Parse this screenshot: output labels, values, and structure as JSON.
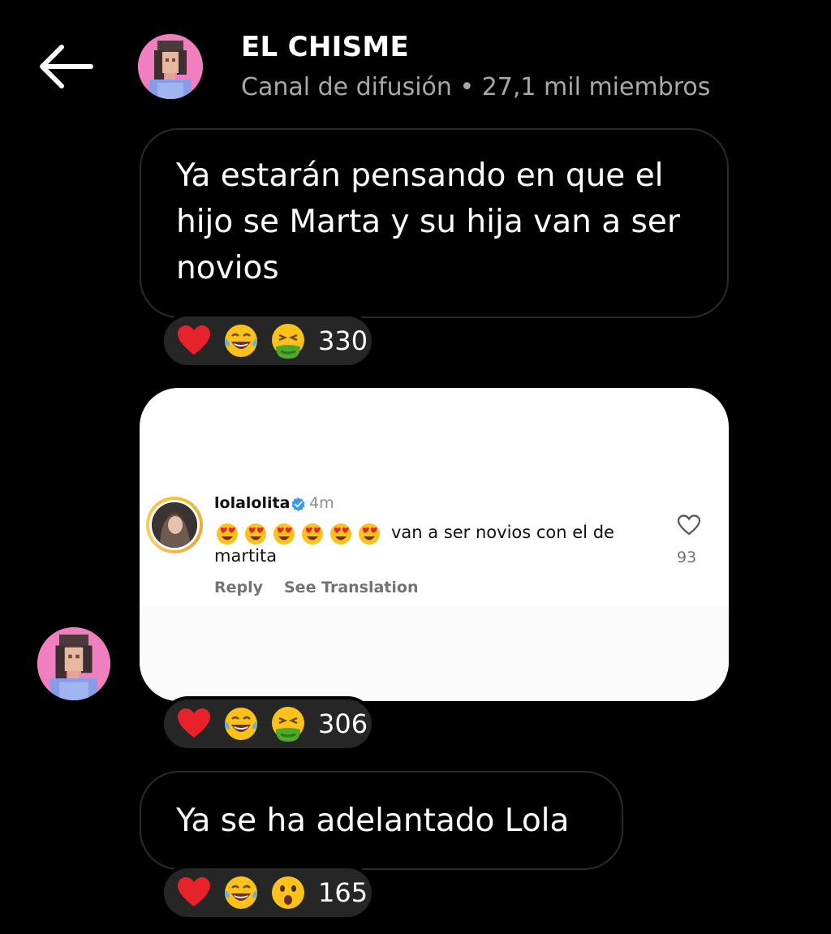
{
  "header": {
    "back_icon": "arrow-left-icon",
    "channel_name": "EL CHISME",
    "subtitle": "Canal de difusión • 27,1 mil miembros",
    "avatar_color": "#f07fc0"
  },
  "messages": [
    {
      "text": "Ya estarán pensando en que el hijo se Marta y su hija van a ser novios",
      "lines": [
        "Ya estarán pensando en que el",
        "hijo se Marta y su hija van a ser",
        "novios"
      ],
      "reactions": [
        "red-heart",
        "tears-of-joy",
        "nauseated-face"
      ],
      "reaction_count": "330"
    },
    {
      "type": "image",
      "embedded_comment": {
        "username": "lolalolita",
        "verified_icon": "verified-badge-icon",
        "time": "4m",
        "emoji_count": 6,
        "emoji": "heart-eyes",
        "comment_text": "van a ser novios con el de",
        "comment_text_line2": "martita",
        "likes": "93",
        "reply_label": "Reply",
        "translate_label": "See Translation"
      },
      "reactions": [
        "red-heart",
        "tears-of-joy",
        "nauseated-face"
      ],
      "reaction_count": "306"
    },
    {
      "text": "Ya se ha adelantado Lola",
      "reactions": [
        "red-heart",
        "tears-of-joy",
        "astonished-face"
      ],
      "reaction_count": "165"
    }
  ],
  "colors": {
    "background": "#000000",
    "bubble_border": "#2a2a2a",
    "reaction_pill": "#262626",
    "subtitle": "#a8a8a8",
    "verified": "#3897f0"
  }
}
